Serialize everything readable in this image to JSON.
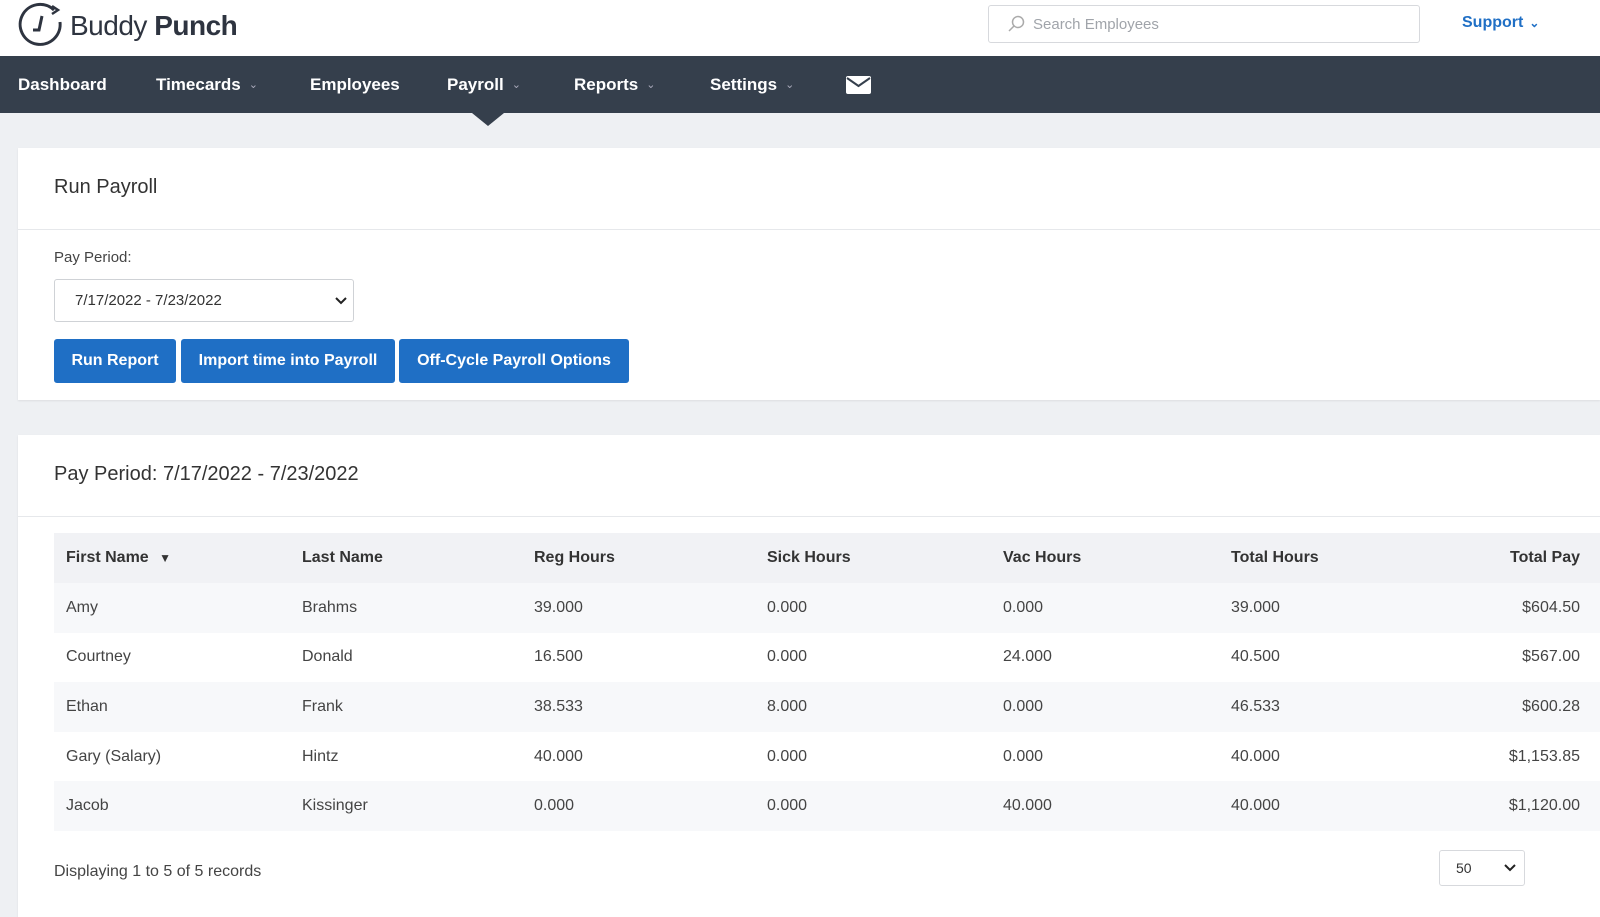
{
  "header": {
    "brand_light": "Buddy",
    "brand_bold": "Punch",
    "search_placeholder": "Search Employees",
    "support_label": "Support"
  },
  "nav": {
    "items": [
      {
        "label": "Dashboard",
        "dropdown": false
      },
      {
        "label": "Timecards",
        "dropdown": true
      },
      {
        "label": "Employees",
        "dropdown": false
      },
      {
        "label": "Payroll",
        "dropdown": true,
        "active": true
      },
      {
        "label": "Reports",
        "dropdown": true
      },
      {
        "label": "Settings",
        "dropdown": true
      }
    ],
    "mail_icon": "envelope-icon"
  },
  "run_payroll": {
    "title": "Run Payroll",
    "pay_period_label": "Pay Period:",
    "pay_period_value": "7/17/2022 - 7/23/2022",
    "buttons": [
      "Run Report",
      "Import time into Payroll",
      "Off-Cycle Payroll Options"
    ]
  },
  "results": {
    "title": "Pay Period: 7/17/2022 - 7/23/2022",
    "columns": [
      "First Name",
      "Last Name",
      "Reg Hours",
      "Sick Hours",
      "Vac Hours",
      "Total Hours",
      "Total Pay"
    ],
    "rows": [
      [
        "Amy",
        "Brahms",
        "39.000",
        "0.000",
        "0.000",
        "39.000",
        "$604.50"
      ],
      [
        "Courtney",
        "Donald",
        "16.500",
        "0.000",
        "24.000",
        "40.500",
        "$567.00"
      ],
      [
        "Ethan",
        "Frank",
        "38.533",
        "8.000",
        "0.000",
        "46.533",
        "$600.28"
      ],
      [
        "Gary (Salary)",
        "Hintz",
        "40.000",
        "0.000",
        "0.000",
        "40.000",
        "$1,153.85"
      ],
      [
        "Jacob",
        "Kissinger",
        "0.000",
        "0.000",
        "40.000",
        "40.000",
        "$1,120.00"
      ]
    ],
    "footer": "Displaying 1 to 5 of 5 records",
    "page_size": "50"
  },
  "colors": {
    "nav_bg": "#353f4c",
    "accent": "#1f6fc5"
  }
}
